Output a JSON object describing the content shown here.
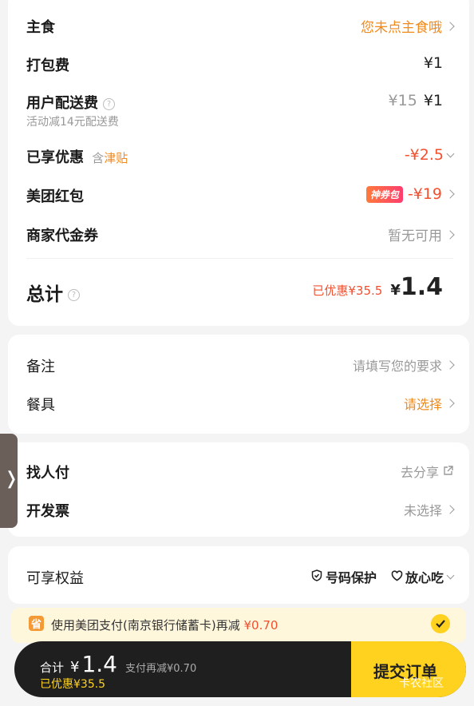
{
  "summary": {
    "staple_label": "主食",
    "staple_value": "您未点主食哦",
    "packing_label": "打包费",
    "packing_value": "¥1",
    "delivery_label": "用户配送费",
    "delivery_original": "¥15",
    "delivery_value": "¥1",
    "delivery_note": "活动减14元配送费",
    "discount_label": "已享优惠",
    "discount_tag_prefix": "含",
    "discount_tag": "津贴",
    "discount_value": "-¥2.5",
    "redpacket_label": "美团红包",
    "redpacket_badge": "神券包",
    "redpacket_value": "-¥19",
    "voucher_label": "商家代金券",
    "voucher_value": "暂无可用",
    "total_label": "总计",
    "total_saved": "已优惠¥35.5",
    "total_currency": "¥",
    "total_amount": "1.4"
  },
  "extras": {
    "note_label": "备注",
    "note_placeholder": "请填写您的要求",
    "tableware_label": "餐具",
    "tableware_value": "请选择"
  },
  "payment": {
    "payfor_label": "找人付",
    "payfor_value": "去分享",
    "invoice_label": "开发票",
    "invoice_value": "未选择"
  },
  "benefits": {
    "label": "可享权益",
    "item1": "号码保护",
    "item2": "放心吃"
  },
  "banner": {
    "icon_char": "省",
    "text": "使用美团支付(南京银行储蓄卡)再减",
    "amount": "¥0.70"
  },
  "bottom_bar": {
    "total_label": "合计",
    "currency": "¥",
    "amount": "1.4",
    "extra": "支付再减¥0.70",
    "saved": "已优惠¥35.5",
    "submit": "提交订单",
    "watermark": "卡农社区"
  },
  "side_tab": {
    "glyph": "❭"
  },
  "colors": {
    "accent_orange": "#f08a1c",
    "accent_red": "#f2502f",
    "submit_yellow": "#ffd21f",
    "bar_dark": "#1f1f1f"
  }
}
